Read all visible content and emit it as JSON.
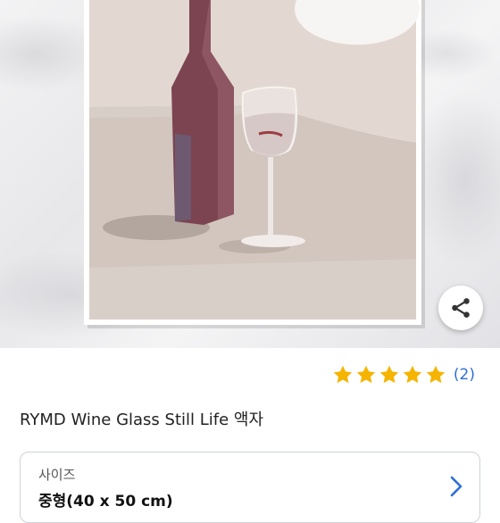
{
  "product": {
    "title": "RYMD Wine Glass Still Life 액자",
    "rating": {
      "stars": 5,
      "max_stars": 5,
      "review_count_label": "(2)"
    }
  },
  "colors": {
    "star": "#f5b400",
    "link": "#2f6fd6",
    "bottle": "#7b4450",
    "frame": "#ffffff"
  },
  "icons": {
    "share": "share-icon",
    "star": "star-icon",
    "chevron": "chevron-right-icon"
  },
  "option": {
    "label": "사이즈",
    "value": "중형(40 x 50 cm)"
  }
}
